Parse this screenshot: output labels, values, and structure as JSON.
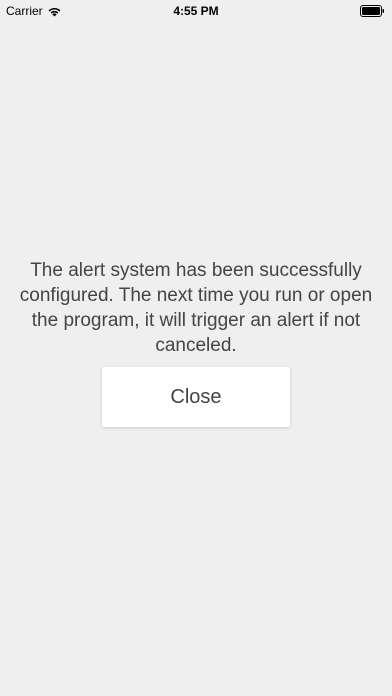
{
  "status_bar": {
    "carrier": "Carrier",
    "time": "4:55 PM",
    "icons": [
      "wifi-icon",
      "battery-icon"
    ]
  },
  "main": {
    "message": "The alert system has been successfully configured. The next time you run or open the program, it will trigger an alert if not canceled.",
    "close_label": "Close"
  },
  "colors": {
    "background": "#efefef",
    "button_background": "#ffffff",
    "text": "#444444"
  }
}
